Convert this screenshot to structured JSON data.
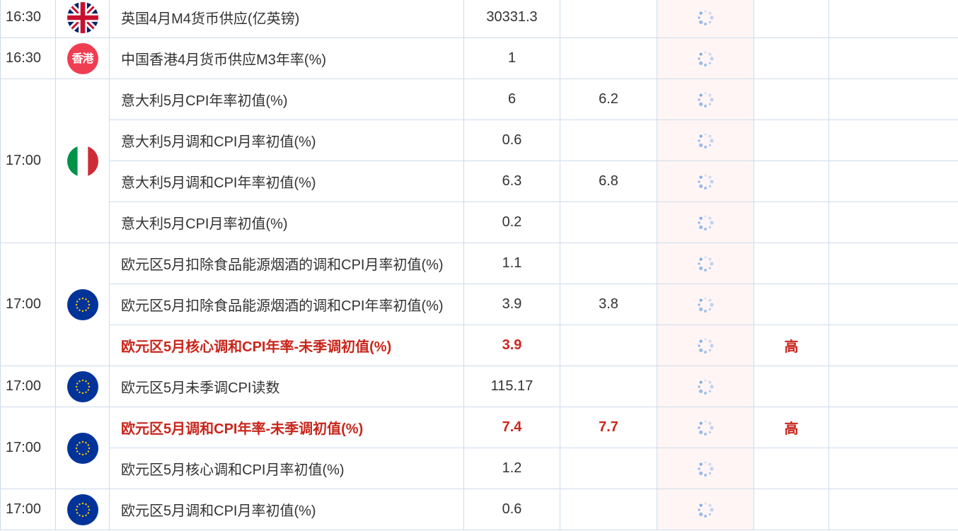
{
  "colors": {
    "highlight": "#c8261c",
    "grid": "#cfdbea",
    "loading_column_bg": "#fff5f5",
    "spinner": "#6fa6e6"
  },
  "rows": [
    {
      "time": "16:30",
      "flag": "uk-flag-icon",
      "name": "英国4月M4货币供应(亿英镑)",
      "actual": "30331.3",
      "forecast": "",
      "importance": "",
      "highlight": false
    },
    {
      "time": "16:30",
      "flag": "hk-flag-icon",
      "flag_text": "香港",
      "name": "中国香港4月货币供应M3年率(%)",
      "actual": "1",
      "forecast": "",
      "importance": "",
      "highlight": false
    },
    {
      "time": "17:00",
      "flag": "italy-flag-icon",
      "name": "意大利5月CPI年率初值(%)",
      "actual": "6",
      "forecast": "6.2",
      "importance": "",
      "highlight": false
    },
    {
      "time": "",
      "flag": "",
      "name": "意大利5月调和CPI月率初值(%)",
      "actual": "0.6",
      "forecast": "",
      "importance": "",
      "highlight": false
    },
    {
      "time": "",
      "flag": "",
      "name": "意大利5月调和CPI年率初值(%)",
      "actual": "6.3",
      "forecast": "6.8",
      "importance": "",
      "highlight": false
    },
    {
      "time": "",
      "flag": "",
      "name": "意大利5月CPI月率初值(%)",
      "actual": "0.2",
      "forecast": "",
      "importance": "",
      "highlight": false
    },
    {
      "time": "17:00",
      "flag": "eu-flag-icon",
      "name": "欧元区5月扣除食品能源烟酒的调和CPI月率初值(%)",
      "actual": "1.1",
      "forecast": "",
      "importance": "",
      "highlight": false
    },
    {
      "time": "",
      "flag": "",
      "name": "欧元区5月扣除食品能源烟酒的调和CPI年率初值(%)",
      "actual": "3.9",
      "forecast": "3.8",
      "importance": "",
      "highlight": false
    },
    {
      "time": "",
      "flag": "",
      "name": "欧元区5月核心调和CPI年率-未季调初值(%)",
      "actual": "3.9",
      "forecast": "",
      "importance": "高",
      "highlight": true
    },
    {
      "time": "17:00",
      "flag": "eu-flag-icon",
      "name": "欧元区5月未季调CPI读数",
      "actual": "115.17",
      "forecast": "",
      "importance": "",
      "highlight": false
    },
    {
      "time": "17:00",
      "flag": "eu-flag-icon",
      "name": "欧元区5月调和CPI年率-未季调初值(%)",
      "actual": "7.4",
      "forecast": "7.7",
      "importance": "高",
      "highlight": true
    },
    {
      "time": "",
      "flag": "",
      "name": "欧元区5月核心调和CPI月率初值(%)",
      "actual": "1.2",
      "forecast": "",
      "importance": "",
      "highlight": false
    },
    {
      "time": "17:00",
      "flag": "eu-flag-icon",
      "name": "欧元区5月调和CPI月率初值(%)",
      "actual": "0.6",
      "forecast": "",
      "importance": "",
      "highlight": false
    }
  ]
}
